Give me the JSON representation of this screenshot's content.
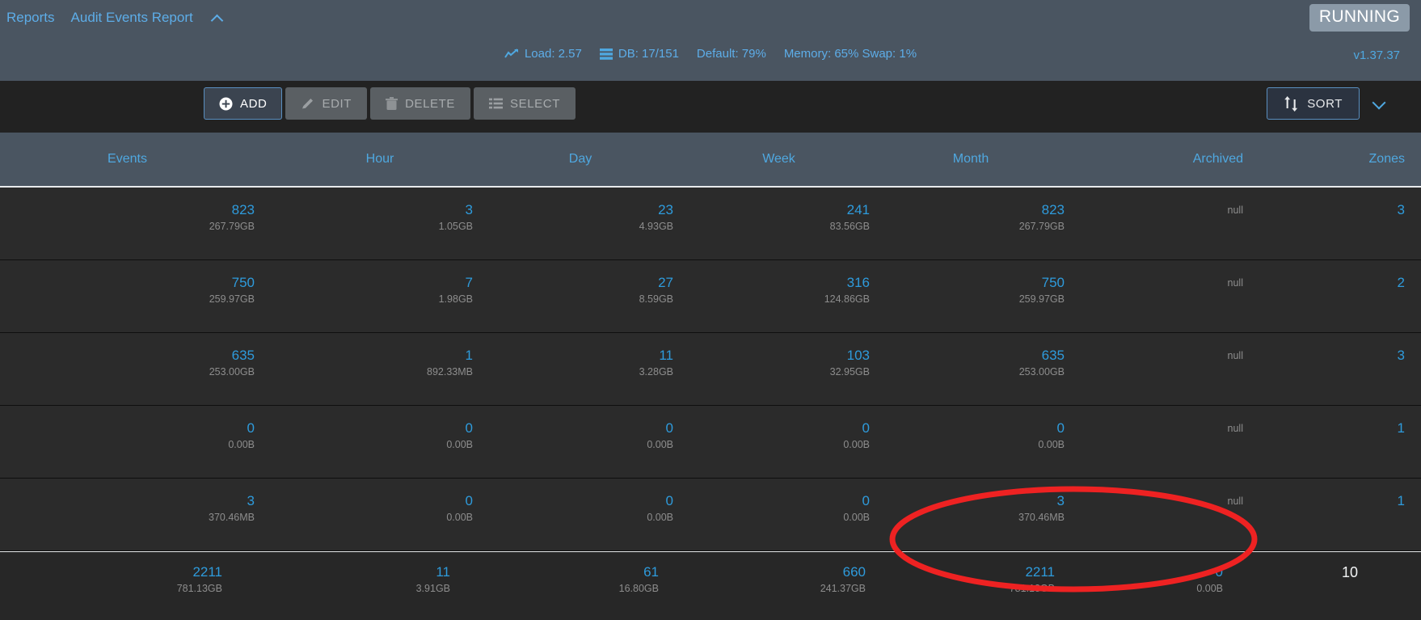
{
  "header": {
    "breadcrumb": [
      {
        "label": "Reports"
      },
      {
        "label": "Audit Events Report"
      }
    ],
    "collapse_icon": "chevron-up-icon",
    "status": "RUNNING",
    "version": "v1.37.37",
    "metrics": [
      {
        "icon": "trending-up-icon",
        "label": "Load: 2.57"
      },
      {
        "icon": "database-icon",
        "label": "DB: 17/151"
      },
      {
        "icon": "",
        "label": "Default: 79%"
      },
      {
        "icon": "",
        "label": "Memory: 65% Swap: 1%"
      }
    ],
    "accent": "#4fa8e0",
    "badge_bg": "#8b9aa8",
    "bar_bg": "#4a5561"
  },
  "toolbar": {
    "buttons": [
      {
        "label": "ADD",
        "icon": "plus-circle-icon",
        "state": "enabled"
      },
      {
        "label": "EDIT",
        "icon": "pencil-icon",
        "state": "disabled"
      },
      {
        "label": "DELETE",
        "icon": "trash-icon",
        "state": "disabled"
      },
      {
        "label": "SELECT",
        "icon": "list-icon",
        "state": "disabled"
      }
    ],
    "sort_label": "SORT",
    "sort_icon": "sort-arrows-icon",
    "expand_icon": "chevron-down-icon"
  },
  "table": {
    "columns": [
      "Events",
      "Hour",
      "Day",
      "Week",
      "Month",
      "Archived",
      "Zones"
    ],
    "rows": [
      {
        "events": {
          "count": "823",
          "size": "267.79GB"
        },
        "hour": {
          "count": "3",
          "size": "1.05GB"
        },
        "day": {
          "count": "23",
          "size": "4.93GB"
        },
        "week": {
          "count": "241",
          "size": "83.56GB"
        },
        "month": {
          "count": "823",
          "size": "267.79GB"
        },
        "archived": "null",
        "zones": "3"
      },
      {
        "events": {
          "count": "750",
          "size": "259.97GB"
        },
        "hour": {
          "count": "7",
          "size": "1.98GB"
        },
        "day": {
          "count": "27",
          "size": "8.59GB"
        },
        "week": {
          "count": "316",
          "size": "124.86GB"
        },
        "month": {
          "count": "750",
          "size": "259.97GB"
        },
        "archived": "null",
        "zones": "2"
      },
      {
        "events": {
          "count": "635",
          "size": "253.00GB"
        },
        "hour": {
          "count": "1",
          "size": "892.33MB"
        },
        "day": {
          "count": "11",
          "size": "3.28GB"
        },
        "week": {
          "count": "103",
          "size": "32.95GB"
        },
        "month": {
          "count": "635",
          "size": "253.00GB"
        },
        "archived": "null",
        "zones": "3"
      },
      {
        "events": {
          "count": "0",
          "size": "0.00B"
        },
        "hour": {
          "count": "0",
          "size": "0.00B"
        },
        "day": {
          "count": "0",
          "size": "0.00B"
        },
        "week": {
          "count": "0",
          "size": "0.00B"
        },
        "month": {
          "count": "0",
          "size": "0.00B"
        },
        "archived": "null",
        "zones": "1"
      },
      {
        "events": {
          "count": "3",
          "size": "370.46MB"
        },
        "hour": {
          "count": "0",
          "size": "0.00B"
        },
        "day": {
          "count": "0",
          "size": "0.00B"
        },
        "week": {
          "count": "0",
          "size": "0.00B"
        },
        "month": {
          "count": "3",
          "size": "370.46MB"
        },
        "archived": "null",
        "zones": "1"
      }
    ],
    "total": {
      "events": {
        "count": "2211",
        "size": "781.13GB"
      },
      "hour": {
        "count": "11",
        "size": "3.91GB"
      },
      "day": {
        "count": "61",
        "size": "16.80GB"
      },
      "week": {
        "count": "660",
        "size": "241.37GB"
      },
      "month": {
        "count": "2211",
        "size": "781.13GB"
      },
      "archived": {
        "count": "0",
        "size": "0.00B"
      },
      "zones": "10"
    }
  },
  "annotation": {
    "shape": "ellipse",
    "color": "#ee2222",
    "target": "total-row-archived-and-zones"
  }
}
